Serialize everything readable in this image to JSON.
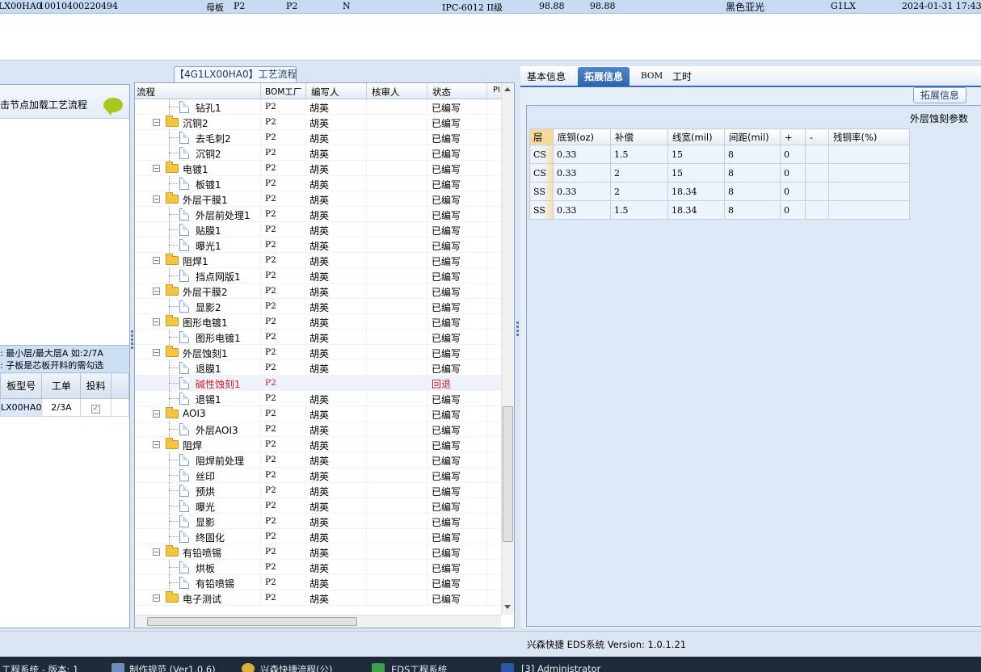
{
  "topbar": {
    "cells": [
      "LX00HA0",
      "10010400220494",
      "母板",
      "P2",
      "P2",
      "N",
      "IPC-6012 II级",
      "98.88",
      "98.88",
      "黑色亚光",
      "G1LX",
      "2024-01-31 17:43"
    ]
  },
  "left": {
    "hint": "击节点加载工艺流程",
    "note1": ": 最小层/最大层A 如:2/7A",
    "note2": ": 子板是芯板开料的需勾选",
    "grid_headers": [
      "板型号",
      "工单",
      "投料"
    ],
    "grid_row": {
      "model": "LX00HA0",
      "order": "2/3A",
      "check": "✓"
    }
  },
  "center": {
    "title": "【4G1LX00HA0】工艺流程",
    "headers": [
      "流程",
      "BOM工厂",
      "编写人",
      "核审人",
      "状态",
      "PI"
    ],
    "rows": [
      {
        "name": "钻孔1",
        "bom": "P2",
        "author": "胡英",
        "status": "已编写",
        "kind": "file"
      },
      {
        "name": "沉铜2",
        "bom": "P2",
        "author": "胡英",
        "status": "已编写",
        "kind": "folder"
      },
      {
        "name": "去毛刺2",
        "bom": "P2",
        "author": "胡英",
        "status": "已编写",
        "kind": "file"
      },
      {
        "name": "沉铜2",
        "bom": "P2",
        "author": "胡英",
        "status": "已编写",
        "kind": "file"
      },
      {
        "name": "电镀1",
        "bom": "P2",
        "author": "胡英",
        "status": "已编写",
        "kind": "folder"
      },
      {
        "name": "板镀1",
        "bom": "P2",
        "author": "胡英",
        "status": "已编写",
        "kind": "file"
      },
      {
        "name": "外层干膜1",
        "bom": "P2",
        "author": "胡英",
        "status": "已编写",
        "kind": "folder"
      },
      {
        "name": "外层前处理1",
        "bom": "P2",
        "author": "胡英",
        "status": "已编写",
        "kind": "file"
      },
      {
        "name": "贴膜1",
        "bom": "P2",
        "author": "胡英",
        "status": "已编写",
        "kind": "file"
      },
      {
        "name": "曝光1",
        "bom": "P2",
        "author": "胡英",
        "status": "已编写",
        "kind": "file"
      },
      {
        "name": "阻焊1",
        "bom": "P2",
        "author": "胡英",
        "status": "已编写",
        "kind": "folder"
      },
      {
        "name": "挡点网版1",
        "bom": "P2",
        "author": "胡英",
        "status": "已编写",
        "kind": "file"
      },
      {
        "name": "外层干膜2",
        "bom": "P2",
        "author": "胡英",
        "status": "已编写",
        "kind": "folder"
      },
      {
        "name": "显影2",
        "bom": "P2",
        "author": "胡英",
        "status": "已编写",
        "kind": "file"
      },
      {
        "name": "图形电镀1",
        "bom": "P2",
        "author": "胡英",
        "status": "已编写",
        "kind": "folder"
      },
      {
        "name": "图形电镀1",
        "bom": "P2",
        "author": "胡英",
        "status": "已编写",
        "kind": "file"
      },
      {
        "name": "外层蚀刻1",
        "bom": "P2",
        "author": "胡英",
        "status": "已编写",
        "kind": "folder"
      },
      {
        "name": "退膜1",
        "bom": "P2",
        "author": "胡英",
        "status": "已编写",
        "kind": "file"
      },
      {
        "name": "碱性蚀刻1",
        "bom": "P2",
        "author": "",
        "status": "回退",
        "kind": "file",
        "highlight": true
      },
      {
        "name": "退锡1",
        "bom": "P2",
        "author": "胡英",
        "status": "已编写",
        "kind": "file"
      },
      {
        "name": "AOI3",
        "bom": "P2",
        "author": "胡英",
        "status": "已编写",
        "kind": "folder"
      },
      {
        "name": "外层AOI3",
        "bom": "P2",
        "author": "胡英",
        "status": "已编写",
        "kind": "file"
      },
      {
        "name": "阻焊",
        "bom": "P2",
        "author": "胡英",
        "status": "已编写",
        "kind": "folder"
      },
      {
        "name": "阻焊前处理",
        "bom": "P2",
        "author": "胡英",
        "status": "已编写",
        "kind": "file"
      },
      {
        "name": "丝印",
        "bom": "P2",
        "author": "胡英",
        "status": "已编写",
        "kind": "file"
      },
      {
        "name": "预烘",
        "bom": "P2",
        "author": "胡英",
        "status": "已编写",
        "kind": "file"
      },
      {
        "name": "曝光",
        "bom": "P2",
        "author": "胡英",
        "status": "已编写",
        "kind": "file"
      },
      {
        "name": "显影",
        "bom": "P2",
        "author": "胡英",
        "status": "已编写",
        "kind": "file"
      },
      {
        "name": "终固化",
        "bom": "P2",
        "author": "胡英",
        "status": "已编写",
        "kind": "file"
      },
      {
        "name": "有铅喷锡",
        "bom": "P2",
        "author": "胡英",
        "status": "已编写",
        "kind": "folder"
      },
      {
        "name": "烘板",
        "bom": "P2",
        "author": "胡英",
        "status": "已编写",
        "kind": "file"
      },
      {
        "name": "有铅喷锡",
        "bom": "P2",
        "author": "胡英",
        "status": "已编写",
        "kind": "file"
      },
      {
        "name": "电子测试",
        "bom": "P2",
        "author": "胡英",
        "status": "已编写",
        "kind": "folder"
      }
    ]
  },
  "right": {
    "tabs": [
      "基本信息",
      "拓展信息",
      "BOM",
      "工时"
    ],
    "active_tab": 1,
    "ext_button": "拓展信息",
    "section_title": "外层蚀刻参数",
    "param_headers": [
      "层",
      "底铜(oz)",
      "补偿",
      "线宽(mil)",
      "间距(mil)",
      "+",
      "-",
      "残铜率(%)"
    ],
    "param_rows": [
      [
        "CS",
        "0.33",
        "1.5",
        "15",
        "8",
        "0",
        "",
        ""
      ],
      [
        "CS",
        "0.33",
        "2",
        "15",
        "8",
        "0",
        "",
        ""
      ],
      [
        "SS",
        "0.33",
        "2",
        "18.34",
        "8",
        "0",
        "",
        ""
      ],
      [
        "SS",
        "0.33",
        "1.5",
        "18.34",
        "8",
        "0",
        "",
        ""
      ]
    ]
  },
  "status": {
    "version": "兴森快捷 EDS系统 Version: 1.0.1.21"
  },
  "taskbar": {
    "items": [
      "工程系统 - 版本: 1",
      "制作规范 (Ver1.0.6)",
      "兴森快捷流程(公)",
      "EDS工程系统",
      "[3] Administrator"
    ]
  },
  "colors": {
    "accent": "#2c63ad",
    "highlight_text": "#d21a1a",
    "folder": "#f5c542"
  }
}
